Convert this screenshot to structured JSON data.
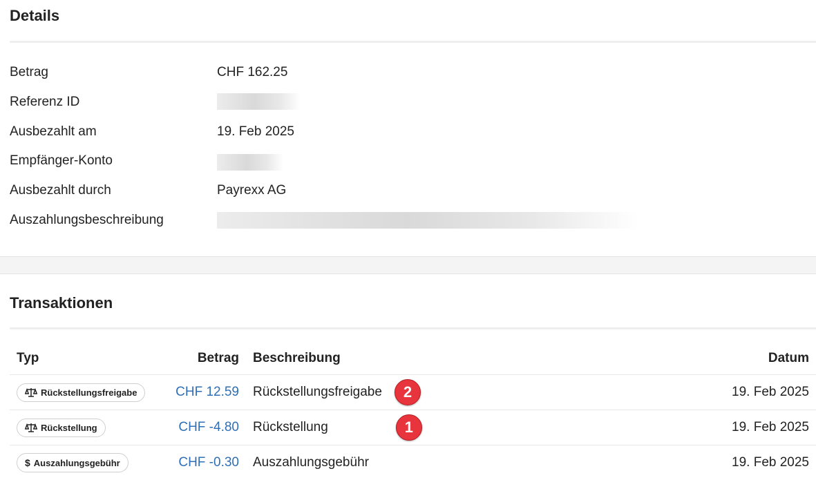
{
  "details": {
    "title": "Details",
    "rows": [
      {
        "label": "Betrag",
        "value": "CHF 162.25"
      },
      {
        "label": "Referenz ID",
        "value": ""
      },
      {
        "label": "Ausbezahlt am",
        "value": "19. Feb 2025"
      },
      {
        "label": "Empfänger-Konto",
        "value": ""
      },
      {
        "label": "Ausbezahlt durch",
        "value": "Payrexx AG"
      },
      {
        "label": "Auszahlungsbeschreibung",
        "value": ""
      }
    ]
  },
  "transactions": {
    "title": "Transaktionen",
    "columns": {
      "type": "Typ",
      "amount": "Betrag",
      "description": "Beschreibung",
      "date": "Datum"
    },
    "rows": [
      {
        "type": "Rückstellungsfreigabe",
        "type_icon": "scale-icon",
        "amount": "CHF 12.59",
        "description": "Rückstellungsfreigabe",
        "badge": "2",
        "date": "19. Feb 2025"
      },
      {
        "type": "Rückstellung",
        "type_icon": "scale-icon",
        "amount": "CHF -4.80",
        "description": "Rückstellung",
        "badge": "1",
        "date": "19. Feb 2025"
      },
      {
        "type": "Auszahlungsgebühr",
        "type_icon": "dollar-icon",
        "amount": "CHF -0.30",
        "description": "Auszahlungsgebühr",
        "badge": "",
        "date": "19. Feb 2025"
      }
    ]
  },
  "colors": {
    "link_amount": "#2f6fb5",
    "badge_red": "#e8343c",
    "divider": "#eeeeee"
  }
}
